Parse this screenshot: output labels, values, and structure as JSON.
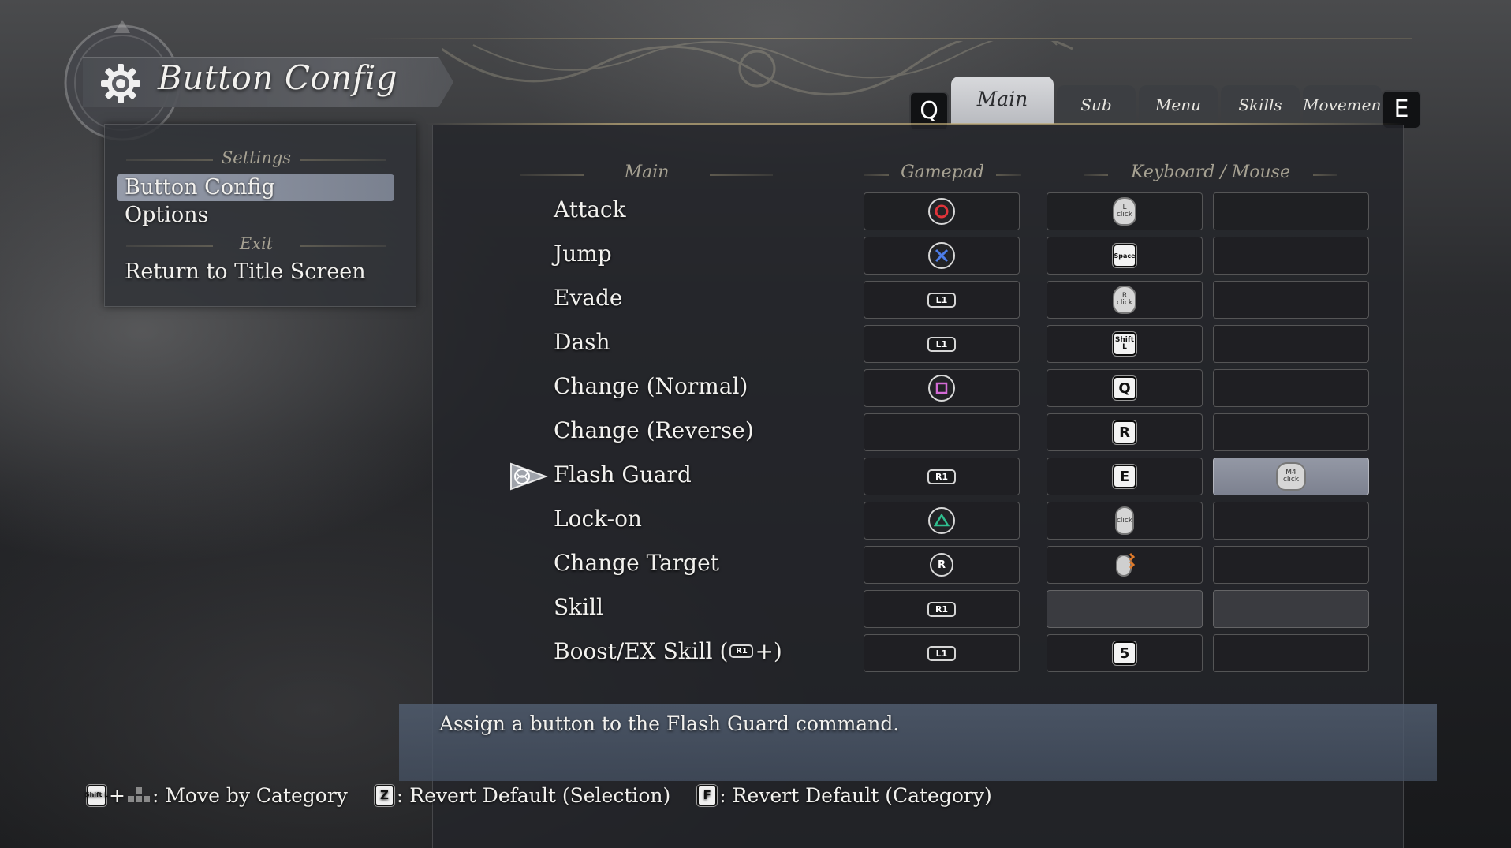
{
  "header": {
    "title": "Button Config"
  },
  "sidebar": {
    "sections": [
      {
        "heading": "Settings",
        "items": [
          "Button Config",
          "Options"
        ]
      },
      {
        "heading": "Exit",
        "items": [
          "Return to Title Screen"
        ]
      }
    ],
    "active_item": "Button Config"
  },
  "tabs": {
    "prev_key": "Q",
    "next_key": "E",
    "items": [
      "Main",
      "Sub",
      "Menu",
      "Skills",
      "Movement"
    ],
    "active": "Main"
  },
  "columns": {
    "action": "Main",
    "gamepad": "Gamepad",
    "keyboard_mouse": "Keyboard / Mouse"
  },
  "rows": [
    {
      "label": "Attack",
      "gamepad": "circle-button-icon",
      "keyboard": "L click",
      "keyboard_alt": ""
    },
    {
      "label": "Jump",
      "gamepad": "cross-button-icon",
      "keyboard": "Space",
      "keyboard_alt": ""
    },
    {
      "label": "Evade",
      "gamepad": "L1",
      "keyboard": "R click",
      "keyboard_alt": ""
    },
    {
      "label": "Dash",
      "gamepad": "L1",
      "keyboard": "Shift L",
      "keyboard_alt": ""
    },
    {
      "label": "Change (Normal)",
      "gamepad": "square-button-icon",
      "keyboard": "Q",
      "keyboard_alt": ""
    },
    {
      "label": "Change (Reverse)",
      "gamepad": "",
      "keyboard": "R",
      "keyboard_alt": ""
    },
    {
      "label": "Flash Guard",
      "gamepad": "R1",
      "keyboard": "E",
      "keyboard_alt": "M4 click",
      "selected": true
    },
    {
      "label": "Lock-on",
      "gamepad": "triangle-button-icon",
      "keyboard": "click",
      "keyboard_alt": ""
    },
    {
      "label": "Change Target",
      "gamepad": "R",
      "keyboard": "mouse-wheel-icon",
      "keyboard_alt": ""
    },
    {
      "label": "Skill",
      "gamepad": "R1",
      "keyboard": "",
      "keyboard_alt": ""
    },
    {
      "label_pre": "Boost/EX Skill (",
      "label_key": "R1",
      "label_post": " +)",
      "gamepad": "L1",
      "keyboard": "5",
      "keyboard_alt": ""
    }
  ],
  "description": "Assign a button to the Flash Guard command.",
  "footer": {
    "hint1_key": "Shift L",
    "hint1_plus": "+",
    "hint1_text": ": Move by Category",
    "hint2_key": "Z",
    "hint2_text": ": Revert Default (Selection)",
    "hint3_key": "F",
    "hint3_text": ": Revert Default (Category)"
  },
  "colors": {
    "accent_gold": "#a6a192",
    "highlight": "#a5acbc",
    "description_bg": "#505c6e",
    "circle": "#e0343a",
    "cross": "#4d7de8",
    "square": "#d46bd6",
    "triangle": "#2fbf8f"
  }
}
